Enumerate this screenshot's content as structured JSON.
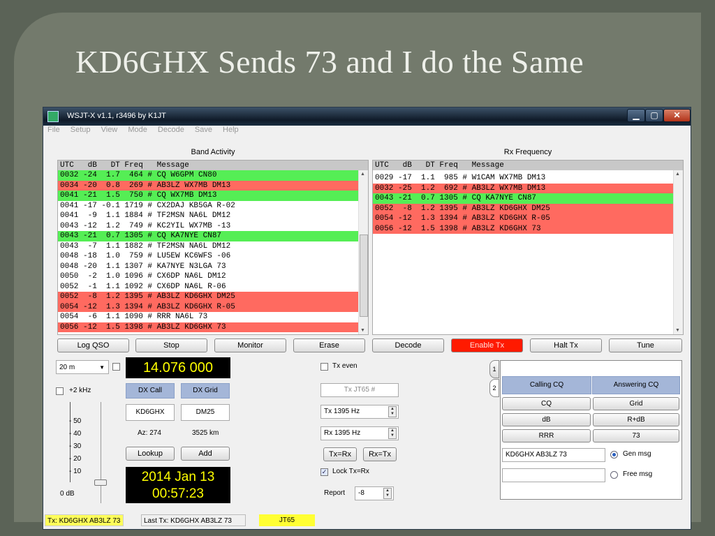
{
  "slide": {
    "title": "KD6GHX Sends 73 and I do the Same"
  },
  "window": {
    "title": "WSJT-X   v1.1, r3496    by K1JT",
    "controls": {
      "minimize": "▁",
      "maximize": "▢",
      "close": "✕"
    }
  },
  "menu": [
    "File",
    "Setup",
    "View",
    "Mode",
    "Decode",
    "Save",
    "Help"
  ],
  "colors": {
    "green": "#55ee55",
    "red": "#ff6a60",
    "enable_tx": "#ff0000",
    "freq_bg": "#000000",
    "freq_fg": "#ffff00",
    "status_mode": "#ffff33"
  },
  "band_activity": {
    "heading": "Band Activity",
    "columns": "UTC   dB   DT Freq   Message",
    "rows": [
      {
        "text": "0032 -24  1.7  464 # CQ W6GPM CN80",
        "color": "green"
      },
      {
        "text": "0034 -20  0.8  269 # AB3LZ WX7MB DM13",
        "color": "red"
      },
      {
        "text": "0041 -21  1.5  750 # CQ WX7MB DM13",
        "color": "green"
      },
      {
        "text": "0041 -17 -0.1 1719 # CX2DAJ KB5GA R-02",
        "color": "none"
      },
      {
        "text": "0041  -9  1.1 1884 # TF2MSN NA6L DM12",
        "color": "none"
      },
      {
        "text": "0043 -12  1.2  749 # KC2YIL WX7MB -13",
        "color": "none"
      },
      {
        "text": "0043 -21  0.7 1305 # CQ KA7NYE CN87",
        "color": "green"
      },
      {
        "text": "0043  -7  1.1 1882 # TF2MSN NA6L DM12",
        "color": "none"
      },
      {
        "text": "0048 -18  1.0  759 # LU5EW KC6WFS -06",
        "color": "none"
      },
      {
        "text": "0048 -20  1.1 1307 # KA7NYE N3LGA 73",
        "color": "none"
      },
      {
        "text": "0050  -2  1.0 1096 # CX6DP NA6L DM12",
        "color": "none"
      },
      {
        "text": "0052  -1  1.1 1092 # CX6DP NA6L R-06",
        "color": "none"
      },
      {
        "text": "0052  -8  1.2 1395 # AB3LZ KD6GHX DM25",
        "color": "red"
      },
      {
        "text": "0054 -12  1.3 1394 # AB3LZ KD6GHX R-05",
        "color": "red"
      },
      {
        "text": "0054  -6  1.1 1090 # RRR NA6L 73",
        "color": "none"
      },
      {
        "text": "0056 -12  1.5 1398 # AB3LZ KD6GHX 73",
        "color": "red"
      }
    ]
  },
  "rx_frequency": {
    "heading": "Rx Frequency",
    "columns": "UTC   dB   DT Freq   Message",
    "rows": [
      {
        "text": "0029 -17  1.1  985 # W1CAM WX7MB DM13",
        "color": "none"
      },
      {
        "text": "0032 -25  1.2  692 # AB3LZ WX7MB DM13",
        "color": "red"
      },
      {
        "text": "0043 -21  0.7 1305 # CQ KA7NYE CN87",
        "color": "green"
      },
      {
        "text": "0052  -8  1.2 1395 # AB3LZ KD6GHX DM25",
        "color": "red"
      },
      {
        "text": "0054 -12  1.3 1394 # AB3LZ KD6GHX R-05",
        "color": "red"
      },
      {
        "text": "0056 -12  1.5 1398 # AB3LZ KD6GHX 73",
        "color": "red"
      }
    ]
  },
  "buttons": {
    "log_qso": "Log QSO",
    "stop": "Stop",
    "monitor": "Monitor",
    "erase": "Erase",
    "decode": "Decode",
    "enable_tx": "Enable Tx",
    "halt_tx": "Halt Tx",
    "tune": "Tune"
  },
  "controls": {
    "band": "20 m",
    "dial_freq": "14.076 000",
    "plus2khz": "+2 kHz",
    "dx_call_label": "DX Call",
    "dx_grid_label": "DX Grid",
    "dx_call": "KD6GHX",
    "dx_grid": "DM25",
    "az": "Az: 274",
    "dist": "3525 km",
    "lookup": "Lookup",
    "add": "Add",
    "date": "2014 Jan 13",
    "time": "00:57:23",
    "meter_ticks": [
      "50",
      "40",
      "30",
      "20",
      "10"
    ],
    "meter_zero": "0  dB",
    "tx_even": "Tx even",
    "tx_jt65": "Tx JT65  #",
    "tx_freq": "Tx  1395  Hz",
    "rx_freq": "Rx  1395  Hz",
    "tx_eq_rx": "Tx=Rx",
    "rx_eq_tx": "Rx=Tx",
    "lock_tx_rx": "Lock Tx=Rx",
    "report_label": "Report",
    "report": "-8"
  },
  "tabs": {
    "tab1": "1",
    "tab2": "2",
    "calling_cq": "Calling CQ",
    "answering_cq": "Answering CQ",
    "cq": "CQ",
    "grid": "Grid",
    "db": "dB",
    "rdb": "R+dB",
    "rrr": "RRR",
    "seventy_three": "73",
    "gen_msg_text": "KD6GHX AB3LZ 73",
    "gen_msg": "Gen msg",
    "free_msg": "Free msg"
  },
  "status": {
    "tx": "Tx: KD6GHX AB3LZ 73",
    "last_tx": "Last Tx:  KD6GHX AB3LZ 73",
    "mode": "JT65"
  }
}
